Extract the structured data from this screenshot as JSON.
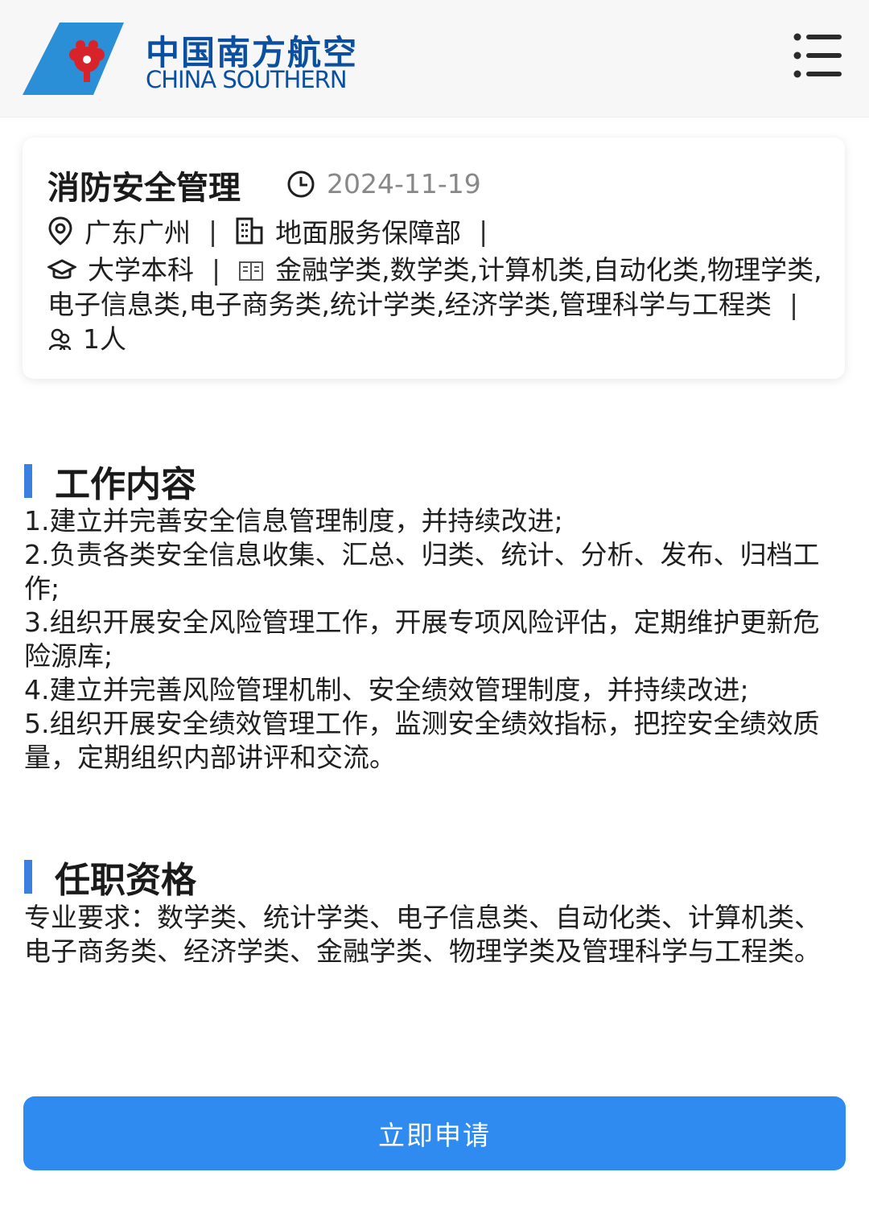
{
  "header": {
    "brand_cn": "中国南方航空",
    "brand_en": "CHINA SOUTHERN",
    "menu_icon": "menu-icon"
  },
  "job": {
    "title": "消防安全管理",
    "date": "2024-11-19",
    "location": "广东广州",
    "department": "地面服务保障部",
    "education": "大学本科",
    "majors": "金融学类,数学类,计算机类,自动化类,物理学类,电子信息类,电子商务类,统计学类,经济学类,管理科学与工程类",
    "headcount": "1人"
  },
  "duties": {
    "title": "工作内容",
    "items": [
      "1.建立并完善安全信息管理制度，并持续改进;",
      "2.负责各类安全信息收集、汇总、归类、统计、分析、发布、归档工作;",
      "3.组织开展安全风险管理工作，开展专项风险评估，定期维护更新危险源库;",
      "4.建立并完善风险管理机制、安全绩效管理制度，并持续改进;",
      "5.组织开展安全绩效管理工作，监测安全绩效指标，把控安全绩效质量，定期组织内部讲评和交流。"
    ]
  },
  "qualifications": {
    "title": "任职资格",
    "text": "专业要求：数学类、统计学类、电子信息类、自动化类、计算机类、电子商务类、经济学类、金融学类、物理学类及管理科学与工程类。"
  },
  "apply_button": "立即申请",
  "colors": {
    "brand": "#0a4fa0",
    "accent": "#3b7fe0",
    "button": "#2f8bef"
  }
}
